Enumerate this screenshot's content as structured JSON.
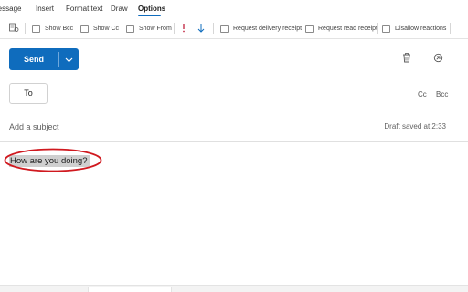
{
  "ribbon": {
    "tabs": [
      {
        "label": "Message"
      },
      {
        "label": "Insert"
      },
      {
        "label": "Format text"
      },
      {
        "label": "Draw"
      },
      {
        "label": "Options"
      }
    ],
    "active_tab": "Options",
    "commands": {
      "show_bcc": "Show Bcc",
      "show_cc": "Show Cc",
      "show_from": "Show From",
      "delivery_receipt": "Request delivery receipt",
      "read_receipt": "Request read receipt",
      "disallow_reactions": "Disallow reactions"
    },
    "colors": {
      "accent": "#0f6cbd",
      "importance_high": "#c4314b",
      "importance_low": "#0f6cbd"
    }
  },
  "compose": {
    "send_label": "Send",
    "to_label": "To",
    "cc_label": "Cc",
    "bcc_label": "Bcc",
    "subject_placeholder": "Add a subject",
    "draft_status": "Draft saved at 2:33",
    "body_text": "How are you doing?",
    "annotation_color": "#d0191f"
  }
}
